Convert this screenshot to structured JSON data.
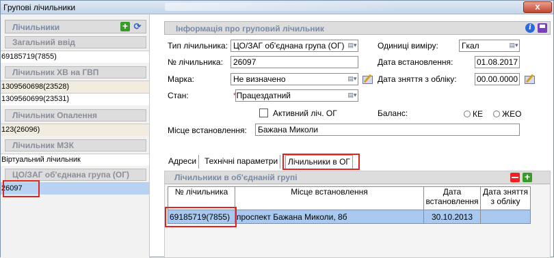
{
  "window": {
    "title": "Групові лічильники",
    "close_label": "x"
  },
  "left": {
    "header": "Лічильники",
    "groups": [
      {
        "name": "Загальний ввід",
        "items": [
          "69185719(7855)"
        ]
      },
      {
        "name": "Лічильник ХВ на ГВП",
        "items": [
          "1309560698(23528)",
          "1309560699(23531)"
        ]
      },
      {
        "name": "Лічильник Опалення",
        "items": [
          "123(26096)"
        ]
      },
      {
        "name": "Лічильник МЗК",
        "items": [
          "Віртуальний лічильник"
        ]
      },
      {
        "name": "ЦО/ЗАГ об'єднана група (ОГ)",
        "items": [
          "26097"
        ]
      }
    ]
  },
  "info": {
    "header": "Інформація про груповий лічильник",
    "type_label": "Тип лічильника:",
    "type_value": "ЦО/ЗАГ об'єднана група (ОГ)",
    "units_label": "Одиниці виміру:",
    "units_value": "Гкал",
    "number_label": "№ лічильника:",
    "number_value": "26097",
    "install_date_label": "Дата встановлення:",
    "install_date_value": "01.08.2017",
    "brand_label": "Марка:",
    "brand_value": "Не визначено",
    "removal_date_label": "Дата зняття з обліку:",
    "removal_date_value": "00.00.0000",
    "state_label": "Стан:",
    "state_required": "*",
    "state_value": "Працездатний",
    "active_label": "Активний ліч. ОГ",
    "balance_label": "Баланс:",
    "balance_options": [
      "КЕ",
      "ЖЕО"
    ],
    "location_label": "Місце встановлення:",
    "location_value": "Бажана Миколи"
  },
  "tabs": [
    "Адреси",
    "Технічні параметри",
    "Лічильники в ОГ"
  ],
  "og": {
    "header": "Лічильники в об'єднаній групі",
    "columns": [
      "№ лічильника",
      "Місце встановлення",
      "Дата встановлення",
      "Дата зняття з обліку"
    ],
    "rows": [
      {
        "number": "69185719(7855)",
        "location": "проспект Бажана Миколи, 8б",
        "install_date": "30.10.2013",
        "removal_date": ""
      }
    ]
  },
  "colors": {
    "highlight": "#e0231f",
    "selection": "#a8c8ef",
    "header_text": "#7a8ca5"
  },
  "icons": [
    "plus-icon",
    "refresh-icon",
    "info-icon",
    "save-icon",
    "dropdown-icon",
    "calendar-icon",
    "minus-icon",
    "close-icon"
  ]
}
